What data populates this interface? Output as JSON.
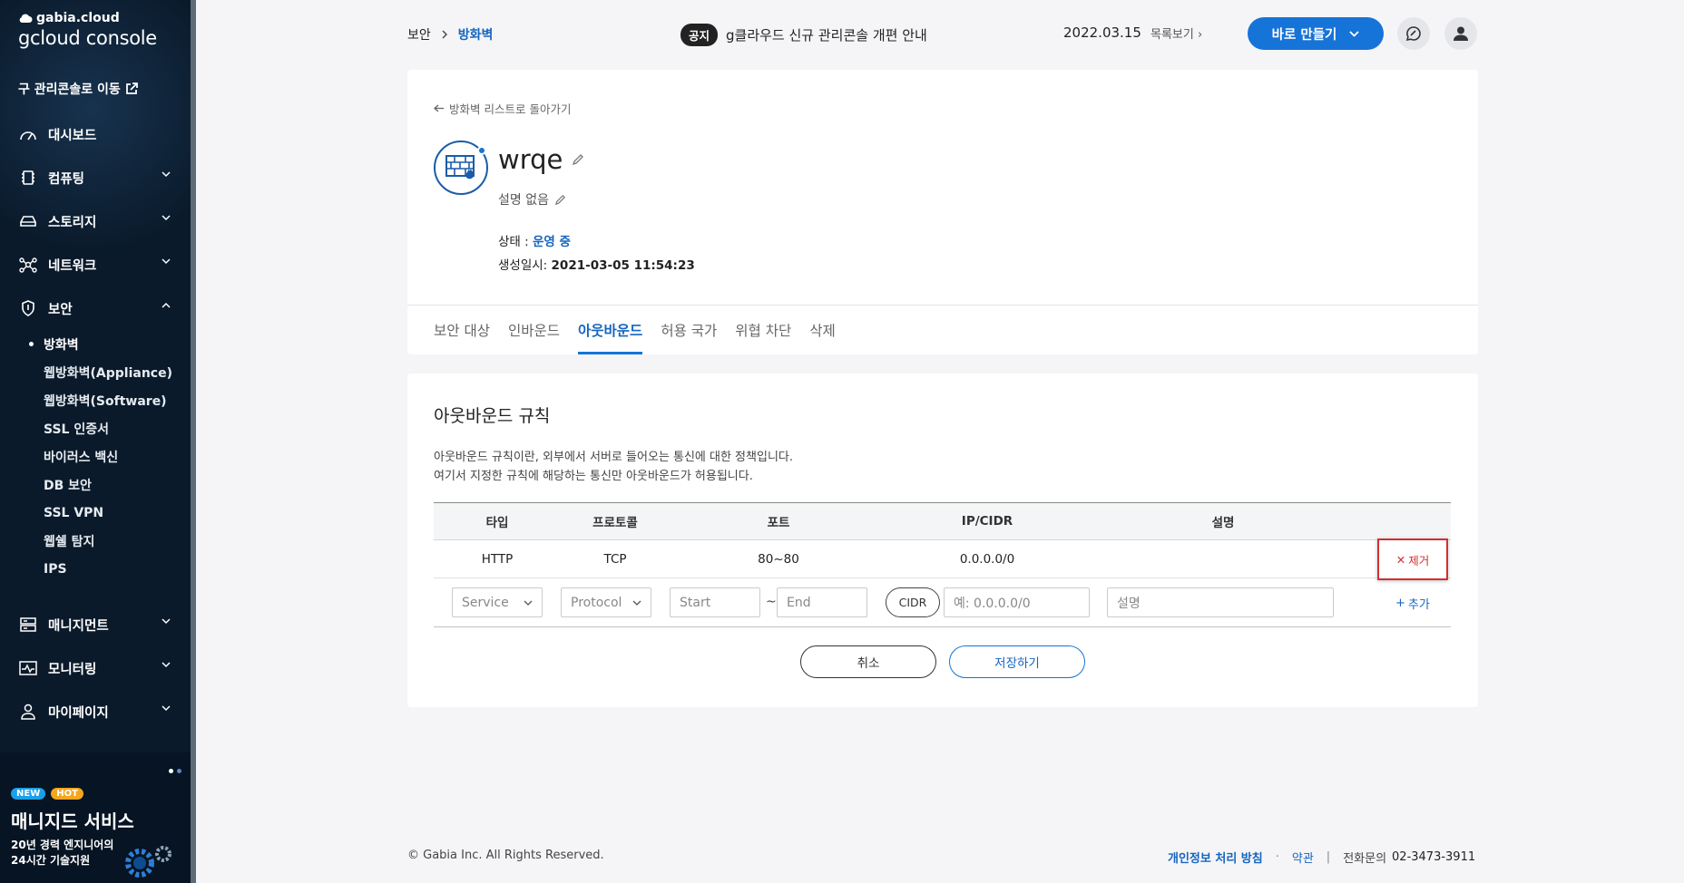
{
  "sidebar": {
    "brand_top": "gabia.cloud",
    "brand_main": "gcloud console",
    "legacy_link": "구 관리콘솔로 이동",
    "menu": [
      {
        "label": "대시보드",
        "icon": "dashboard-icon"
      },
      {
        "label": "컴퓨팅",
        "icon": "compute-icon"
      },
      {
        "label": "스토리지",
        "icon": "storage-icon"
      },
      {
        "label": "네트워크",
        "icon": "network-icon"
      },
      {
        "label": "보안",
        "icon": "shield-icon"
      }
    ],
    "security_sub": [
      "방화벽",
      "웹방화벽(Appliance)",
      "웹방화벽(Software)",
      "SSL 인증서",
      "바이러스 백신",
      "DB 보안",
      "SSL VPN",
      "웹쉘 탐지",
      "IPS"
    ],
    "menu_bottom": [
      {
        "label": "매니지먼트",
        "icon": "management-icon"
      },
      {
        "label": "모니터링",
        "icon": "monitoring-icon"
      },
      {
        "label": "마이페이지",
        "icon": "user-icon"
      }
    ],
    "promo": {
      "badge_new": "NEW",
      "badge_hot": "HOT",
      "title": "매니지드 서비스",
      "line1": "20년 경력 엔지니어의",
      "line2": "24시간 기술지원"
    }
  },
  "header": {
    "breadcrumb": [
      "보안",
      "방화벽"
    ],
    "notice_tag": "공지",
    "notice_text": "g클라우드 신규 관리콘솔 개편 안내",
    "notice_date": "2022.03.15",
    "notice_more": "목록보기",
    "create_label": "바로 만들기"
  },
  "detail": {
    "back_label": "방화벽 리스트로 돌아가기",
    "name": "wrqe",
    "description": "설명 없음",
    "status_label": "상태 : ",
    "status_value": "운영 중",
    "created_label": "생성일시: ",
    "created_value": "2021-03-05 11:54:23",
    "tabs": [
      "보안 대상",
      "인바운드",
      "아웃바운드",
      "허용 국가",
      "위협 차단",
      "삭제"
    ],
    "active_tab": "아웃바운드"
  },
  "rules": {
    "title": "아웃바운드 규칙",
    "desc1": "아웃바운드 규칙이란, 외부에서 서버로 들어오는 통신에 대한 정책입니다.",
    "desc2": "여기서 지정한 규칙에 해당하는 통신만 아웃바운드가 허용됩니다.",
    "columns": [
      "타입",
      "프로토콜",
      "포트",
      "IP/CIDR",
      "설명"
    ],
    "rows": [
      {
        "type": "HTTP",
        "protocol": "TCP",
        "port": "80~80",
        "cidr": "0.0.0.0/0",
        "desc": "",
        "remove": "제거"
      }
    ],
    "input": {
      "service": "Service",
      "protocol": "Protocol",
      "start": "Start",
      "end": "End",
      "tilde": "~",
      "cidr_btn": "CIDR",
      "cidr_placeholder": "예: 0.0.0.0/0",
      "desc_placeholder": "설명",
      "add": "추가"
    },
    "cancel": "취소",
    "save": "저장하기"
  },
  "footer": {
    "copyright": "© Gabia Inc. All Rights Reserved.",
    "privacy": "개인정보 처리 방침",
    "dot": "·",
    "terms": "약관",
    "bar": "|",
    "phone_label": "전화문의",
    "phone": "02-3473-3911"
  },
  "colors": {
    "accent": "#1673d8",
    "sidebar": "#0a1a2b",
    "danger": "#d32f2f"
  }
}
